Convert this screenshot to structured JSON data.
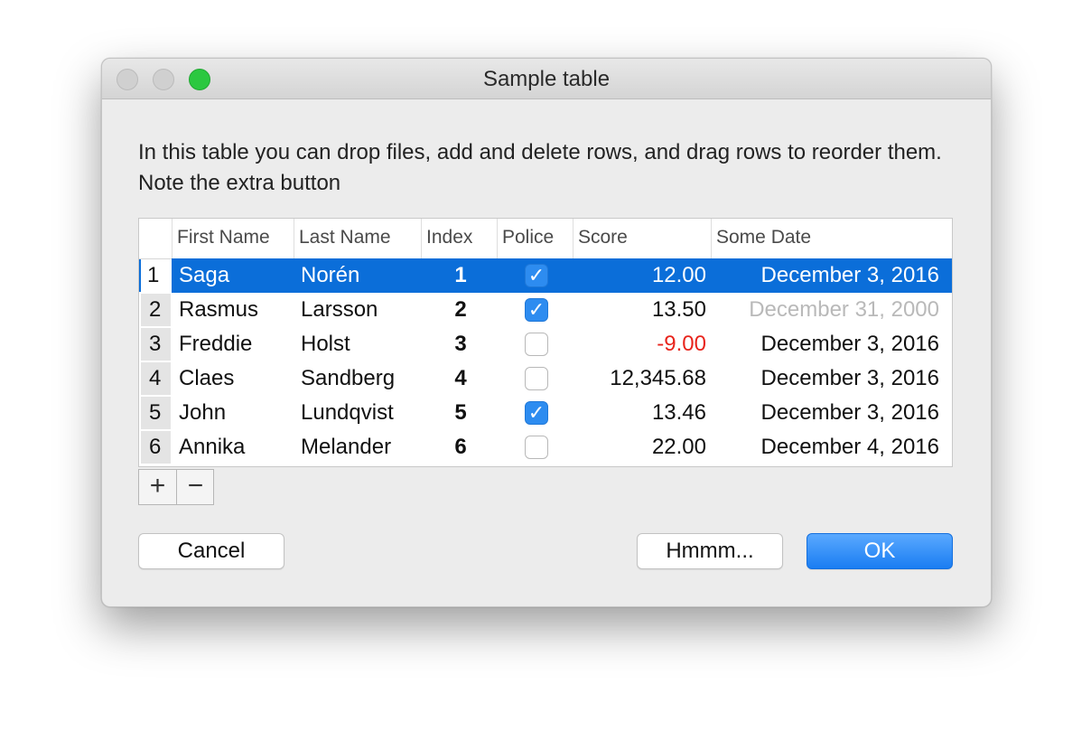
{
  "window": {
    "title": "Sample table"
  },
  "description": "In this table you can drop files, add and delete rows, and drag rows to reorder them. Note the extra button",
  "table": {
    "columns": [
      "First Name",
      "Last Name",
      "Index",
      "Police",
      "Score",
      "Some Date"
    ],
    "rows": [
      {
        "num": "1",
        "first": "Saga",
        "last": "Norén",
        "index": "1",
        "police": true,
        "score": "12.00",
        "date": "December 3, 2016",
        "selected": true
      },
      {
        "num": "2",
        "first": "Rasmus",
        "last": "Larsson",
        "index": "2",
        "police": true,
        "score": "13.50",
        "date": "December 31, 2000",
        "date_dimmed": true
      },
      {
        "num": "3",
        "first": "Freddie",
        "last": "Holst",
        "index": "3",
        "police": false,
        "score": "-9.00",
        "score_negative": true,
        "date": "December 3, 2016"
      },
      {
        "num": "4",
        "first": "Claes",
        "last": "Sandberg",
        "index": "4",
        "police": false,
        "score": "12,345.68",
        "date": "December 3, 2016"
      },
      {
        "num": "5",
        "first": "John",
        "last": "Lundqvist",
        "index": "5",
        "police": true,
        "score": "13.46",
        "date": "December 3, 2016"
      },
      {
        "num": "6",
        "first": "Annika",
        "last": "Melander",
        "index": "6",
        "police": false,
        "score": "22.00",
        "date": "December 4, 2016"
      }
    ]
  },
  "controls": {
    "add": "+",
    "remove": "−"
  },
  "buttons": {
    "cancel": "Cancel",
    "extra": "Hmmm...",
    "ok": "OK"
  },
  "colors": {
    "selection": "#0b6ed9",
    "checkbox_checked": "#2d8cf0",
    "negative": "#e8241c",
    "dimmed_date": "#b9b9b9",
    "ok_button": "#1a7df2",
    "zoom_button": "#2bc840"
  },
  "icons": {
    "check": "check-icon",
    "add": "plus-icon",
    "remove": "minus-icon"
  }
}
